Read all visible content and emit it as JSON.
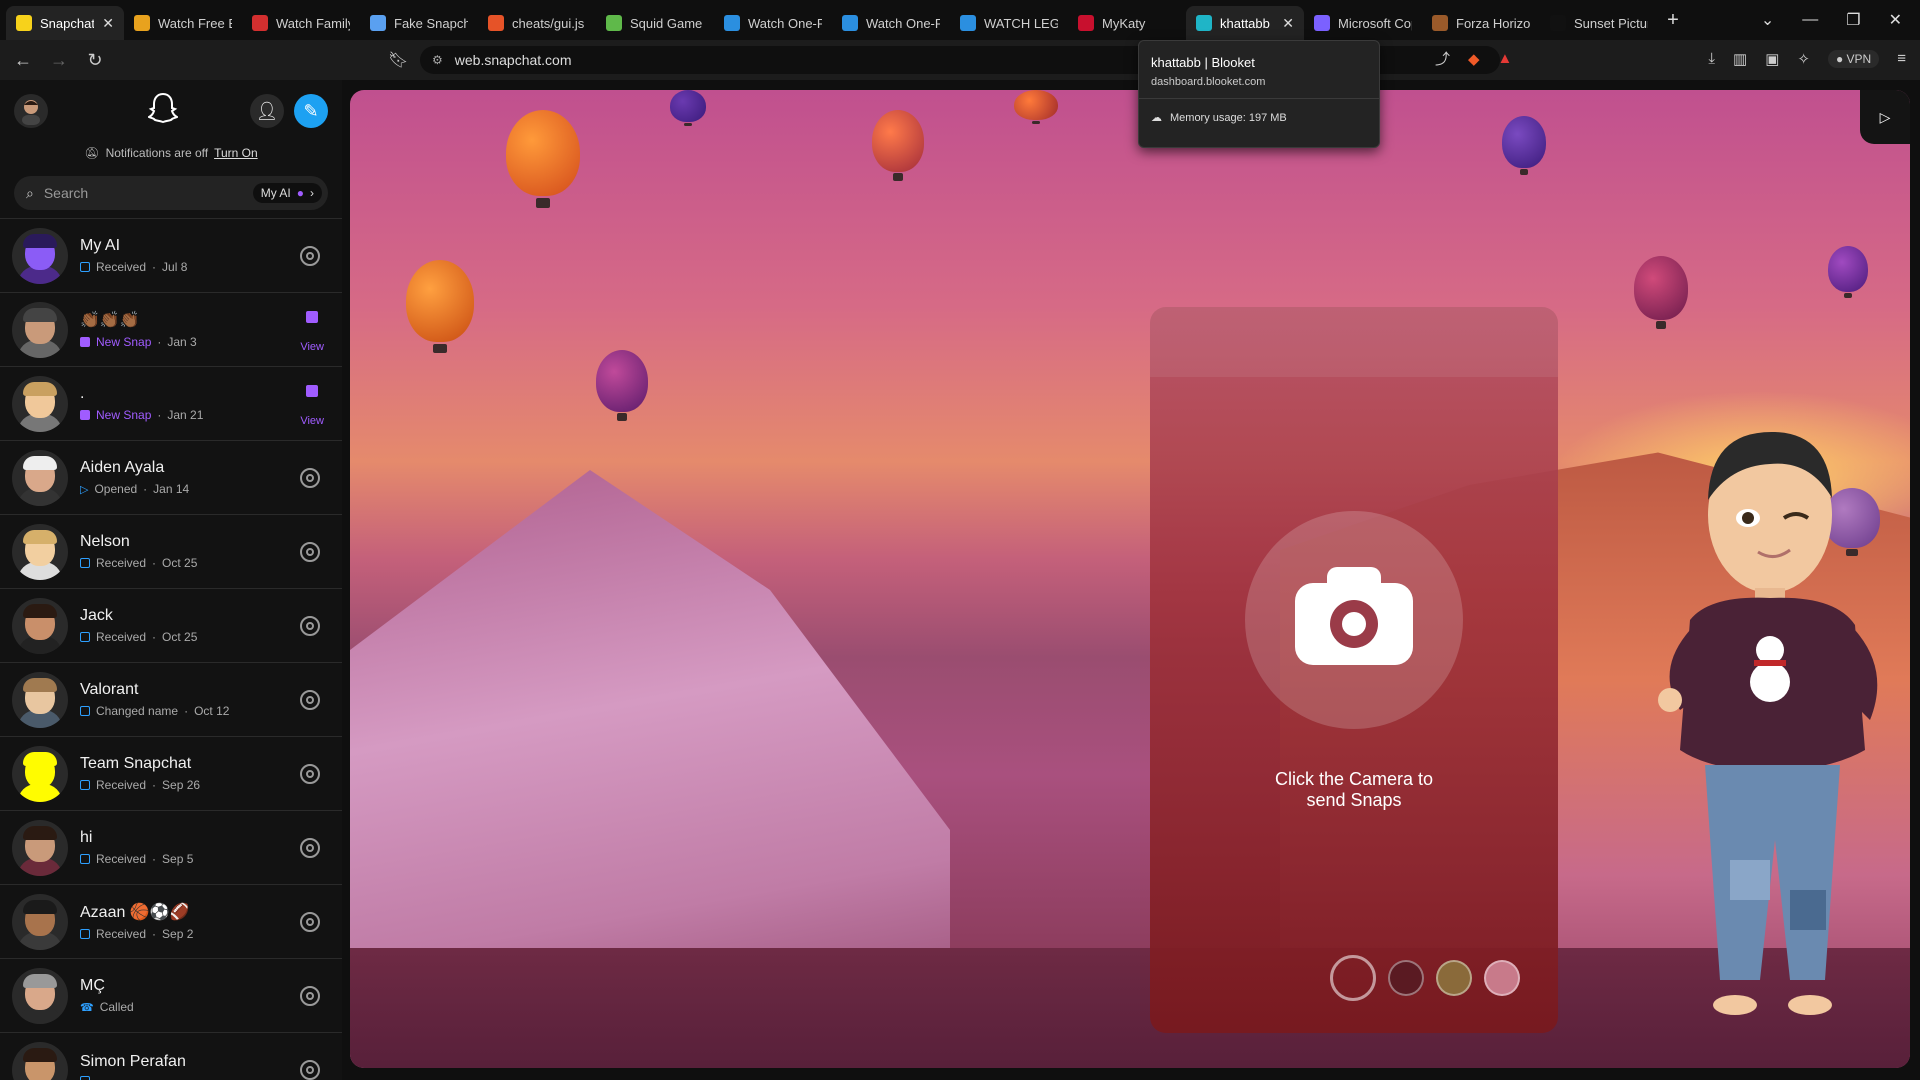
{
  "tabs": [
    {
      "title": "Snapchat",
      "icon": "snapchat-icon",
      "color": "#f7d21b",
      "active": true
    },
    {
      "title": "Watch Free Books",
      "icon": "hd-icon",
      "color": "#e8a21e"
    },
    {
      "title": "Watch Family",
      "icon": "grid-icon",
      "color": "#d32f2f"
    },
    {
      "title": "Fake Snapchat",
      "icon": "doc-icon",
      "color": "#5aa0f0"
    },
    {
      "title": "cheats/gui.js",
      "icon": "gitlab-icon",
      "color": "#e65328"
    },
    {
      "title": "Squid Game",
      "icon": "play-icon",
      "color": "#5fb94a"
    },
    {
      "title": "Watch One-Piece",
      "icon": "s-icon",
      "color": "#2b8fe0"
    },
    {
      "title": "Watch One-Piece",
      "icon": "s-icon",
      "color": "#2b8fe0"
    },
    {
      "title": "WATCH LEGO",
      "icon": "s-icon",
      "color": "#2b8fe0"
    },
    {
      "title": "MyKaty",
      "icon": "mykaty-icon",
      "color": "#c8102e"
    },
    {
      "title": "khattabb | Blooket",
      "icon": "blooket-icon",
      "color": "#1fb5c7",
      "active": true
    },
    {
      "title": "Microsoft Copilot",
      "icon": "copilot-icon",
      "color": "#7b61ff"
    },
    {
      "title": "Forza Horizon",
      "icon": "forza-icon",
      "color": "#9a5a2a"
    },
    {
      "title": "Sunset Pictures",
      "icon": "b-icon",
      "color": "#111111"
    }
  ],
  "address": {
    "url": "web.snapchat.com",
    "vpn_label": "VPN"
  },
  "hover_card": {
    "title": "khattabb | Blooket",
    "domain": "dashboard.blooket.com",
    "memory": "Memory usage: 197 MB"
  },
  "sidebar": {
    "notification_text": "Notifications are off",
    "notification_action": "Turn On",
    "search_placeholder": "Search",
    "my_ai_chip": "My AI",
    "chats": [
      {
        "name": "My AI",
        "status": "Received",
        "time": "Jul 8",
        "kind": "received",
        "skin": "#8b5cf6",
        "hair": "#2a1a5a",
        "body": "#4c2a8a"
      },
      {
        "name": "👏🏾👏🏾👏🏾",
        "status": "New Snap",
        "time": "Jan 3",
        "kind": "new",
        "skin": "#c99a7a",
        "hair": "#444",
        "body": "#666"
      },
      {
        "name": ".",
        "status": "New Snap",
        "time": "Jan 21",
        "kind": "new",
        "skin": "#f0c89a",
        "hair": "#c9a060",
        "body": "#777"
      },
      {
        "name": "Aiden Ayala",
        "status": "Opened",
        "time": "Jan 14",
        "kind": "opened",
        "skin": "#d9a88a",
        "hair": "#eee",
        "body": "#333"
      },
      {
        "name": "Nelson",
        "status": "Received",
        "time": "Oct 25",
        "kind": "received",
        "skin": "#f2cfa0",
        "hair": "#d6b06a",
        "body": "#ddd"
      },
      {
        "name": "Jack",
        "status": "Received",
        "time": "Oct 25",
        "kind": "received",
        "skin": "#c98f6a",
        "hair": "#2a1a12",
        "body": "#222"
      },
      {
        "name": "Valorant",
        "status": "Changed name",
        "time": "Oct 12",
        "kind": "received",
        "skin": "#e8c6a0",
        "hair": "#a07a50",
        "body": "#4a5a6a"
      },
      {
        "name": "Team Snapchat",
        "status": "Received",
        "time": "Sep 26",
        "kind": "received",
        "skin": "#fffc00",
        "hair": "#fffc00",
        "body": "#fffc00"
      },
      {
        "name": "hi",
        "status": "Received",
        "time": "Sep 5",
        "kind": "received",
        "skin": "#c99a7a",
        "hair": "#2a1a12",
        "body": "#6a2a3a"
      },
      {
        "name": "Azaan 🏀⚽🏈",
        "status": "Received",
        "time": "Sep 2",
        "kind": "received",
        "skin": "#a8734c",
        "hair": "#1a1a1a",
        "body": "#3a3a3a"
      },
      {
        "name": "MÇ",
        "status": "Called",
        "time": "",
        "kind": "called",
        "skin": "#d9a88a",
        "hair": "#999",
        "body": "#2a2a2a"
      },
      {
        "name": "Simon Perafan",
        "status": "",
        "time": "",
        "kind": "received",
        "skin": "#c9956a",
        "hair": "#2a1a12",
        "body": "#a0302a"
      }
    ]
  },
  "main": {
    "prompt": "Click the Camera to send Snaps"
  }
}
